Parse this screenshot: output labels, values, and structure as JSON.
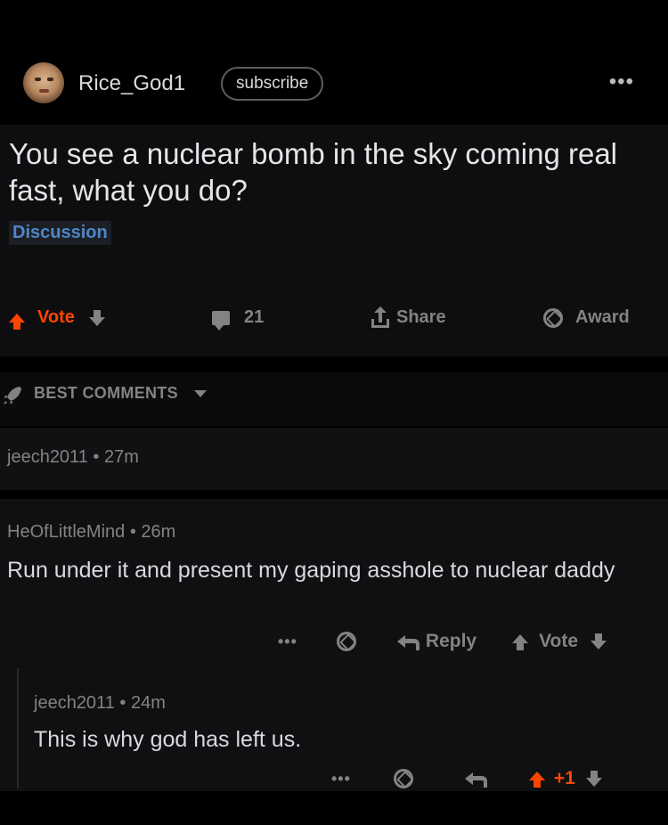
{
  "header": {
    "username": "Rice_God1",
    "subscribe_label": "subscribe",
    "more_label": "•••"
  },
  "post": {
    "title": "You see a nuclear bomb in the sky coming real fast, what you do?",
    "flair": "Discussion",
    "actions": {
      "vote_label": "Vote",
      "comment_count": "21",
      "share_label": "Share",
      "award_label": "Award"
    }
  },
  "sort": {
    "label": "BEST COMMENTS"
  },
  "comments": [
    {
      "author": "jeech2011",
      "time": "27m",
      "separator": "•"
    },
    {
      "author": "HeOfLittleMind",
      "time": "26m",
      "separator": "•",
      "text": "Run under it and present my gaping asshole to nuclear daddy",
      "more_label": "•••",
      "reply_label": "Reply",
      "vote_label": "Vote"
    },
    {
      "author": "jeech2011",
      "time": "24m",
      "separator": "•",
      "text": "This is why god has left us.",
      "more_label": "•••",
      "score": "+1"
    }
  ],
  "colors": {
    "upvote": "#ff4500",
    "flair_text": "#4f86c6",
    "muted": "#818384"
  }
}
